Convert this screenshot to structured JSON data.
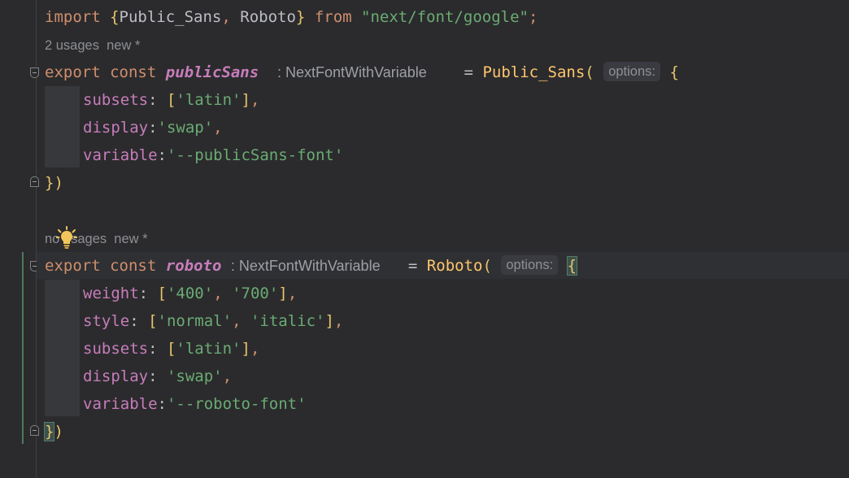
{
  "editor": {
    "line1": {
      "import_kw": "import",
      "open_brace": "{",
      "name1": "Public_Sans",
      "comma": ", ",
      "name2": "Roboto",
      "close_brace": "}",
      "from_kw": "from",
      "module": "\"next/font/google\"",
      "semi": ";"
    },
    "hint1": "2 usages  new *",
    "block1": {
      "export_kw": "export",
      "const_kw": "const",
      "name": "publicSans",
      "type_hint": ": NextFontWithVariable",
      "equals": "=",
      "call": "Public_Sans",
      "paren": "(",
      "param_hint": "options:",
      "brace": "{",
      "props": [
        {
          "key": "subsets",
          "sep": ": ",
          "lb": "[",
          "val": "'latin'",
          "rb": "]",
          "end": ","
        },
        {
          "key": "display",
          "sep": ":",
          "val": "'swap'",
          "end": ","
        },
        {
          "key": "variable",
          "sep": ":",
          "val": "'--publicSans-font'"
        }
      ],
      "closing_brace": "}",
      "closing_paren": ")"
    },
    "hint2": "no usages  new *",
    "block2": {
      "export_kw": "export",
      "const_kw": "const",
      "name": "roboto",
      "type_hint": ": NextFontWithVariable",
      "equals": "=",
      "call": "Roboto",
      "paren": "(",
      "param_hint": "options:",
      "brace": "{",
      "weight": {
        "key": "weight",
        "sep": ": ",
        "lb": "[",
        "v1": "'400'",
        "comma": ", ",
        "v2": "'700'",
        "rb": "]",
        "end": ","
      },
      "style": {
        "key": "style",
        "sep": ": ",
        "lb": "[",
        "v1": "'normal'",
        "comma": ", ",
        "v2": "'italic'",
        "rb": "]",
        "end": ","
      },
      "subsets": {
        "key": "subsets",
        "sep": ": ",
        "lb": "[",
        "val": "'latin'",
        "rb": "]",
        "end": ","
      },
      "display": {
        "key": "display",
        "sep": ": ",
        "val": "'swap'",
        "end": ","
      },
      "variable": {
        "key": "variable",
        "sep": ":",
        "val": "'--roboto-font'"
      },
      "closing_brace": "}",
      "closing_paren": ")"
    },
    "icons": {
      "fold": "fold-marker-icon",
      "bulb": "lightbulb-icon"
    },
    "colors": {
      "background": "#2b2b2d",
      "keyword": "#cf8e6d",
      "function": "#ffc66d",
      "property": "#c77dbb",
      "string": "#6aab73",
      "hint": "#8c8f94",
      "bulb": "#f2c55c"
    }
  }
}
